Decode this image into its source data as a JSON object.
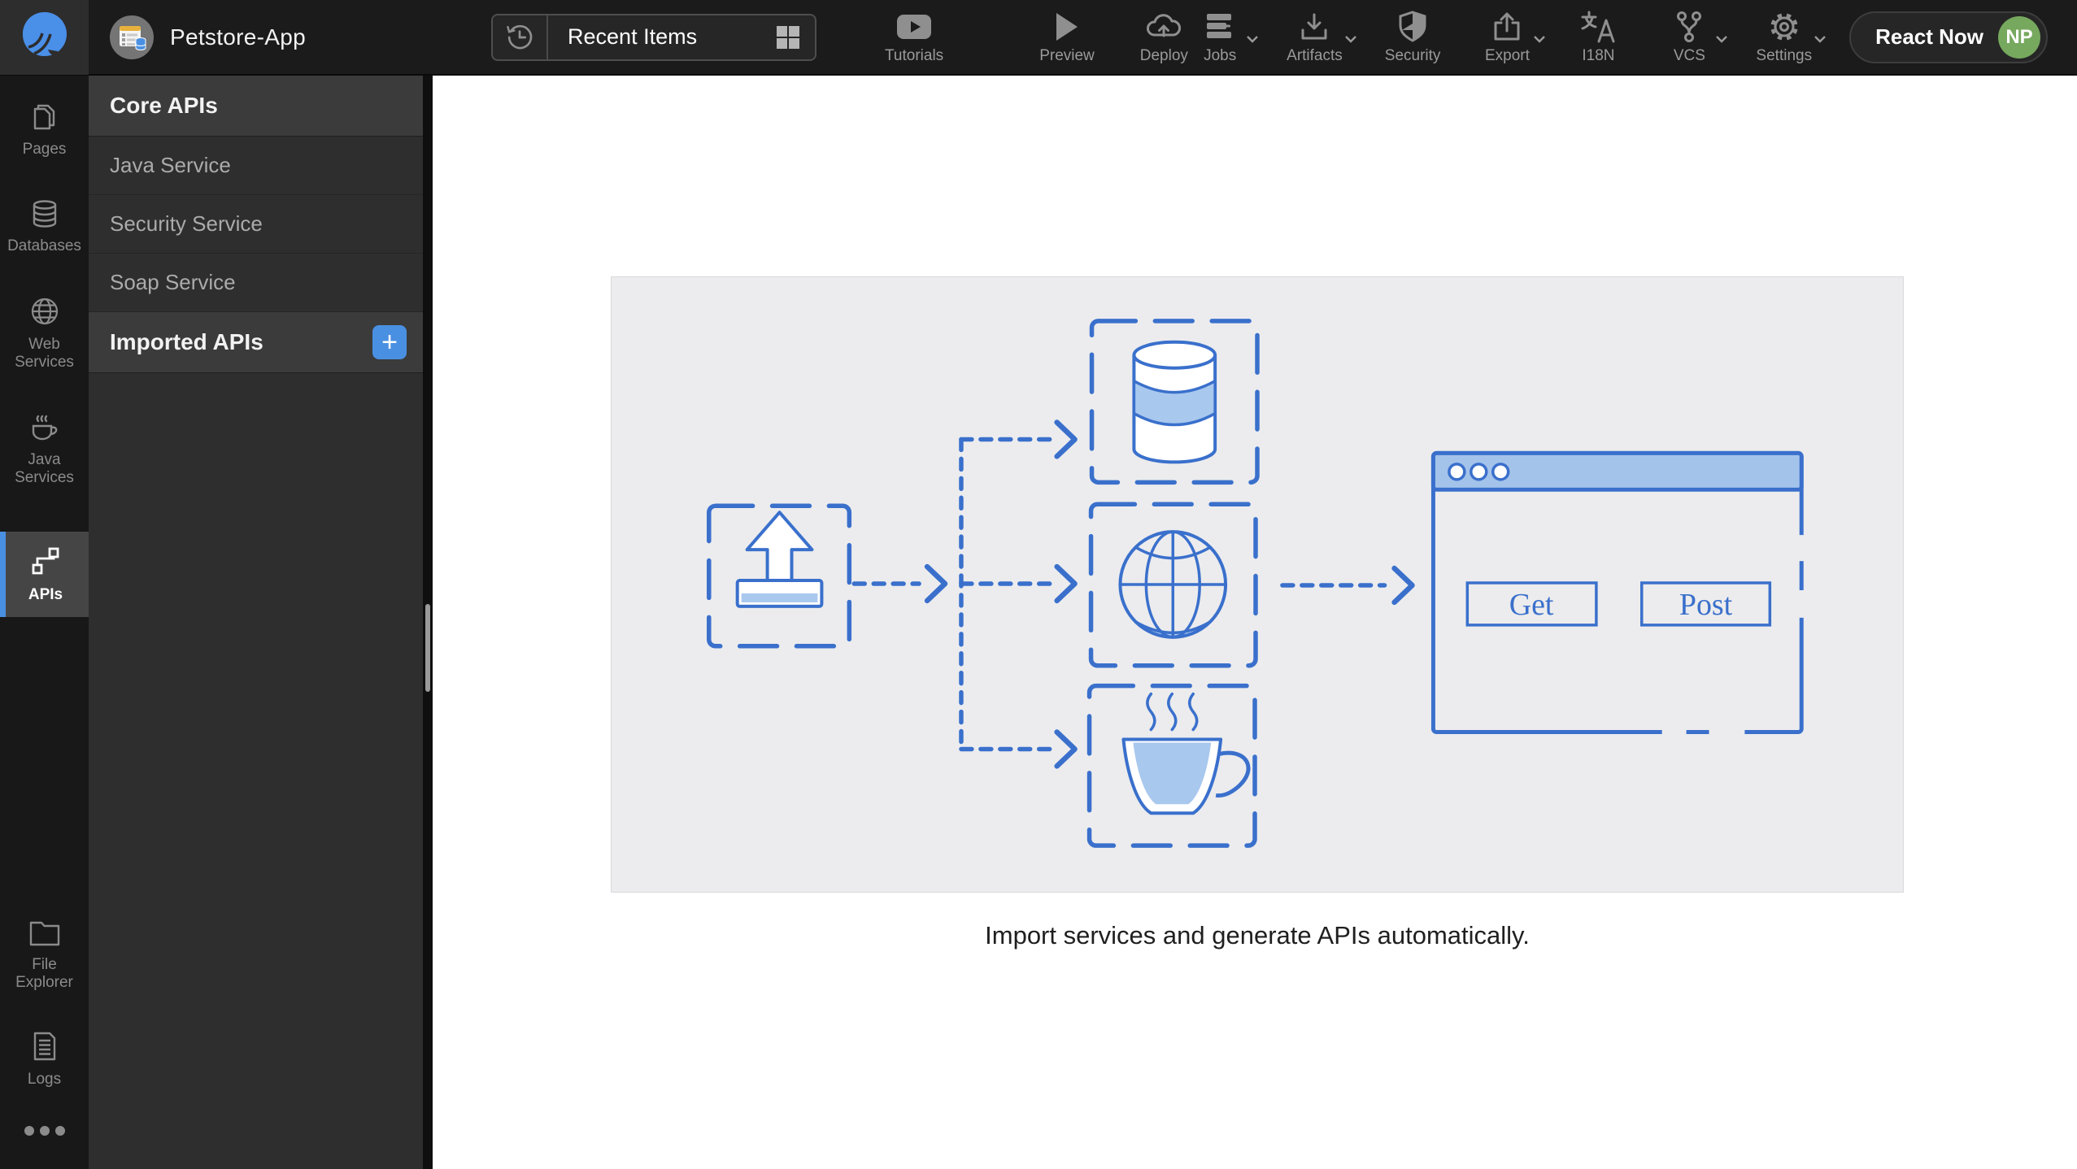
{
  "topbar": {
    "project_name": "Petstore-App",
    "recent_items_label": "Recent Items",
    "actions": {
      "tutorials": "Tutorials",
      "preview": "Preview",
      "deploy": "Deploy"
    },
    "menus": {
      "jobs": "Jobs",
      "artifacts": "Artifacts",
      "security": "Security",
      "export": "Export",
      "i18n": "I18N",
      "vcs": "VCS",
      "settings": "Settings"
    },
    "react_now_label": "React Now",
    "user_initials": "NP"
  },
  "sidebar": {
    "items": [
      {
        "label": "Pages"
      },
      {
        "label": "Databases"
      },
      {
        "label": "Web Services"
      },
      {
        "label": "Java Services"
      },
      {
        "label": "APIs"
      },
      {
        "label": "File Explorer"
      },
      {
        "label": "Logs"
      }
    ],
    "active_item": "APIs"
  },
  "panel": {
    "core_header": "Core APIs",
    "core_items": [
      "Java Service",
      "Security Service",
      "Soap Service"
    ],
    "imported_header": "Imported APIs",
    "add_button": "+"
  },
  "main": {
    "diagram": {
      "get_label": "Get",
      "post_label": "Post"
    },
    "caption": "Import services and generate APIs automatically."
  },
  "colors": {
    "accent_blue": "#4a90e2",
    "diagram_stroke": "#3a70cc",
    "diagram_fill": "#a9c8ee",
    "browser_titlebar": "#a4c3ea",
    "avatar_green": "#76a85e"
  }
}
